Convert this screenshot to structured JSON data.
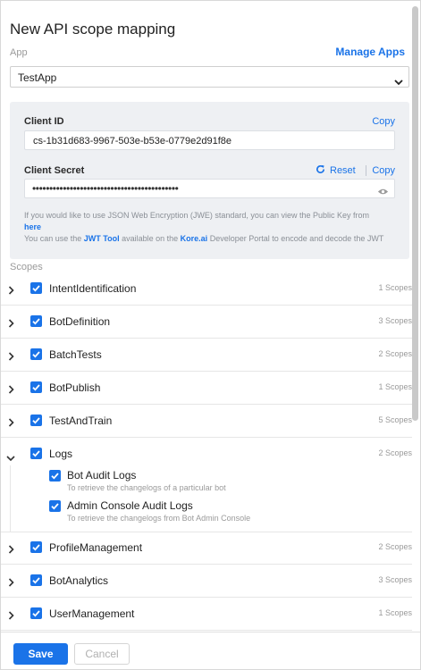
{
  "header": {
    "title": "New API scope mapping"
  },
  "app": {
    "label": "App",
    "manage_link": "Manage Apps",
    "selected": "TestApp"
  },
  "client": {
    "id_label": "Client ID",
    "id_copy": "Copy",
    "id_value": "cs-1b31d683-9967-503e-b53e-0779e2d91f8e",
    "secret_label": "Client Secret",
    "reset": "Reset",
    "secret_copy": "Copy",
    "secret_value": "•••••••••••••••••••••••••••••••••••••••••••"
  },
  "info": {
    "jwe_text": "If you would like to use JSON Web Encryption (JWE) standard, you can view the Public Key from",
    "here_link": "here",
    "tool_prefix": "You can use the",
    "jwt_tool": "JWT Tool",
    "tool_mid": "available on the",
    "kore": "Kore.ai",
    "tool_suffix": "Developer Portal to encode and decode the JWT"
  },
  "scopes": {
    "label": "Scopes",
    "items": [
      {
        "name": "IntentIdentification",
        "count": "1 Scopes"
      },
      {
        "name": "BotDefinition",
        "count": "3 Scopes"
      },
      {
        "name": "BatchTests",
        "count": "2 Scopes"
      },
      {
        "name": "BotPublish",
        "count": "1 Scopes"
      },
      {
        "name": "TestAndTrain",
        "count": "5 Scopes"
      },
      {
        "name": "Logs",
        "count": "2 Scopes"
      },
      {
        "name": "ProfileManagement",
        "count": "2 Scopes"
      },
      {
        "name": "BotAnalytics",
        "count": "3 Scopes"
      },
      {
        "name": "UserManagement",
        "count": "1 Scopes"
      }
    ],
    "logs_children": [
      {
        "name": "Bot Audit Logs",
        "desc": "To retrieve the changelogs of a particular bot"
      },
      {
        "name": "Admin Console Audit Logs",
        "desc": "To retrieve the changelogs from Bot Admin Console"
      }
    ]
  },
  "footer": {
    "save": "Save",
    "cancel": "Cancel"
  },
  "colors": {
    "accent": "#1a73e8",
    "panel_bg": "#eef0f3"
  },
  "icons": {
    "expand": "chevron-right-icon",
    "collapse": "chevron-down-icon",
    "checkbox": "checkbox-checked-icon",
    "reset": "refresh-icon",
    "visibility": "eye-icon"
  }
}
